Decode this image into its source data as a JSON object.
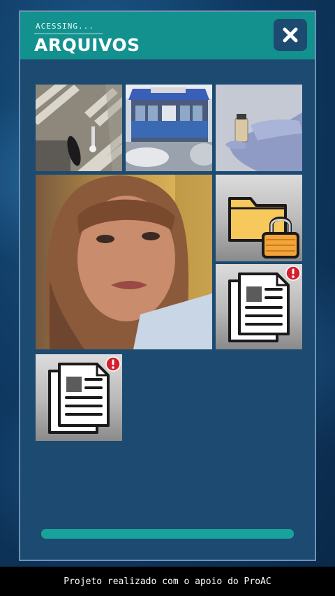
{
  "header": {
    "subtitle": "ACESSING...",
    "title": "ARQUIVOS",
    "close_icon": "close-icon"
  },
  "files": [
    {
      "label": "photo-crosswalk",
      "type": "image",
      "locked": false,
      "alert": false
    },
    {
      "label": "photo-building",
      "type": "image",
      "locked": false,
      "alert": false
    },
    {
      "label": "photo-vial",
      "type": "image",
      "locked": false,
      "alert": false
    },
    {
      "label": "photo-girl",
      "type": "image",
      "locked": false,
      "alert": false
    },
    {
      "label": "locked-folder",
      "type": "folder",
      "locked": true,
      "alert": false
    },
    {
      "label": "document",
      "type": "document",
      "locked": false,
      "alert": true
    },
    {
      "label": "document",
      "type": "document",
      "locked": false,
      "alert": true
    }
  ],
  "progress": {
    "value": 1.0
  },
  "footer": {
    "text": "Projeto realizado com o apoio do ProAC"
  },
  "colors": {
    "accent": "#13918e",
    "panel": "#1d4a70",
    "alert": "#d3202f",
    "folder": "#f7c85c",
    "lock": "#f3a53a"
  }
}
